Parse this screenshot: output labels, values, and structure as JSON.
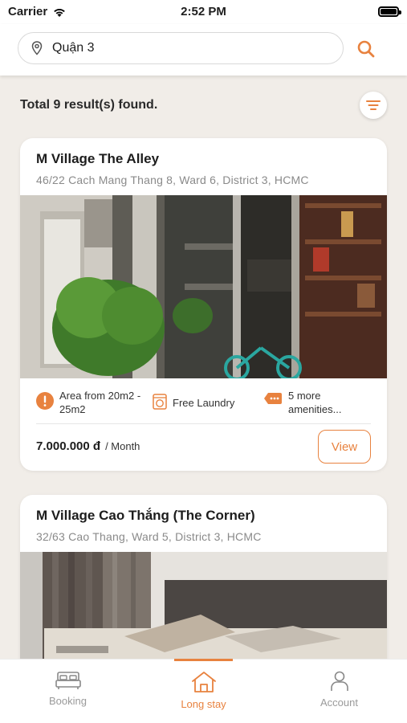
{
  "status_bar": {
    "carrier": "Carrier",
    "time": "2:52 PM"
  },
  "search": {
    "value": "Quận 3"
  },
  "results": {
    "summary": "Total 9 result(s) found."
  },
  "listings": [
    {
      "title": "M Village The Alley",
      "address": "46/22 Cach Mang Thang 8, Ward 6, District 3, HCMC",
      "amenities": [
        {
          "icon": "alert-icon",
          "label": "Area from 20m2 - 25m2"
        },
        {
          "icon": "laundry-icon",
          "label": "Free Laundry"
        },
        {
          "icon": "more-tag-icon",
          "label": "5 more amenities..."
        }
      ],
      "price": "7.000.000 đ",
      "price_unit": "/ Month",
      "view_label": "View"
    },
    {
      "title": "M Village Cao Thắng (The Corner)",
      "address": "32/63 Cao Thang, Ward 5, District 3, HCMC"
    }
  ],
  "tabs": [
    {
      "label": "Booking",
      "icon": "bed-icon"
    },
    {
      "label": "Long stay",
      "icon": "house-icon",
      "active": true
    },
    {
      "label": "Account",
      "icon": "person-icon"
    }
  ],
  "colors": {
    "accent": "#e8823f",
    "background": "#f1ede8"
  }
}
